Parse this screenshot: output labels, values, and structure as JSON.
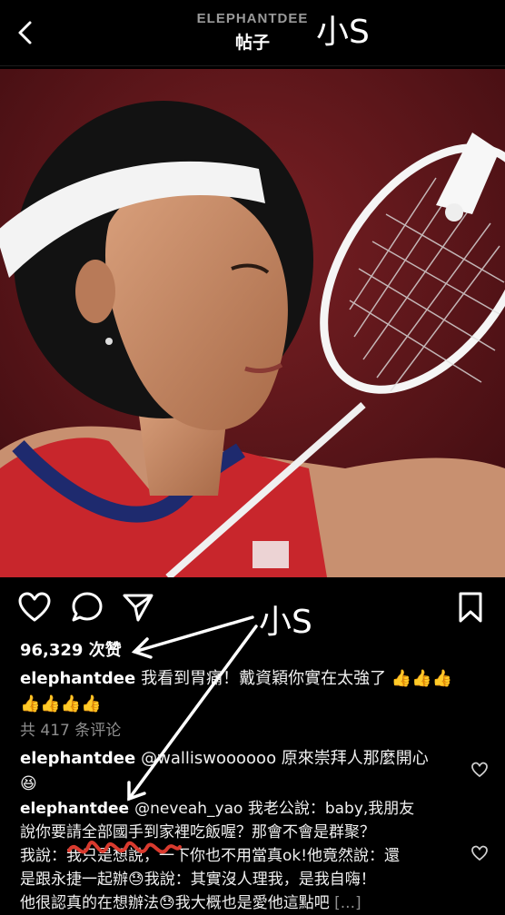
{
  "header": {
    "username": "ELEPHANTDEE",
    "title": "帖子",
    "handwritten_note": "小S"
  },
  "post": {
    "likes": "96,329 次赞",
    "view_all_comments": "共 417 条评论",
    "handwritten_note": "小S"
  },
  "comments": [
    {
      "user": "elephantdee",
      "text": "我看到胃痛！戴資穎你實在太強了",
      "emojis": "👍👍👍👍👍👍👍"
    },
    {
      "user": "elephantdee",
      "text": "@walliswoooooo 原來崇拜人那麼開心",
      "emojis": "😆"
    },
    {
      "user": "elephantdee",
      "line1": "@neveah_yao 我老公說：baby,我朋友",
      "line2": "說你要請全部國手到家裡吃飯喔？那會不會是群聚？",
      "line3": "我說：我只是想說，一下你也不用當真ok!他竟然說：還",
      "line4": "是跟永捷一起辦😓我說：其實沒人理我，是我自嗨！",
      "line5": "他很認真的在想辦法😓我大概也是愛他這點吧",
      "more": "[...]"
    }
  ],
  "icons": [
    "back-icon",
    "heart-icon",
    "comment-icon",
    "share-icon",
    "bookmark-icon"
  ],
  "colors": {
    "background": "#000000",
    "muted_text": "#8e8e8e",
    "scribble": "#d93a2e"
  }
}
